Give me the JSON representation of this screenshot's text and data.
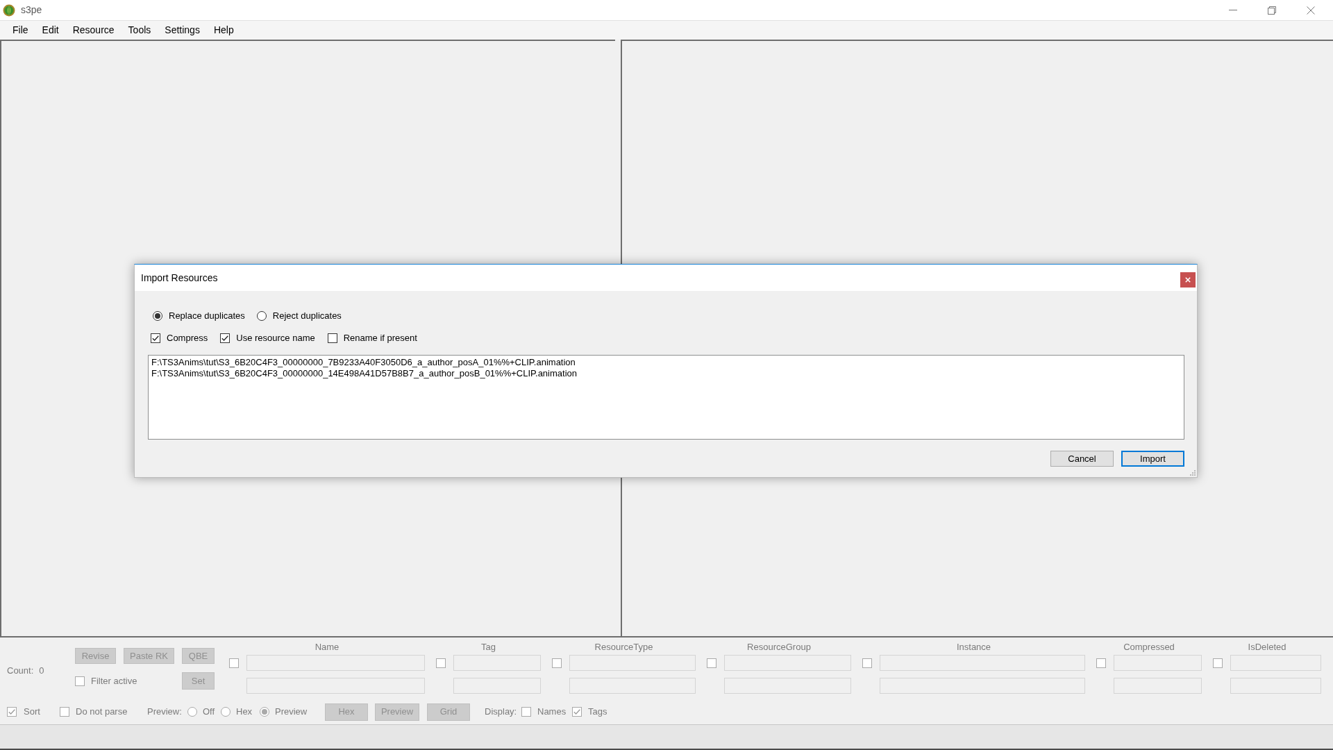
{
  "window": {
    "title": "s3pe"
  },
  "menu": [
    "File",
    "Edit",
    "Resource",
    "Tools",
    "Settings",
    "Help"
  ],
  "dialog": {
    "title": "Import Resources",
    "duplicate_options": [
      {
        "label": "Replace duplicates",
        "selected": true
      },
      {
        "label": "Reject duplicates",
        "selected": false
      }
    ],
    "options": [
      {
        "label": "Compress",
        "checked": true
      },
      {
        "label": "Use resource name",
        "checked": true
      },
      {
        "label": "Rename if present",
        "checked": false
      }
    ],
    "files": [
      "F:\\TS3Anims\\tut\\S3_6B20C4F3_00000000_7B9233A40F3050D6_a_author_posA_01%%+CLIP.animation",
      "F:\\TS3Anims\\tut\\S3_6B20C4F3_00000000_14E498A41D57B8B7_a_author_posB_01%%+CLIP.animation"
    ],
    "buttons": [
      {
        "label": "Cancel",
        "default": false
      },
      {
        "label": "Import",
        "default": true
      }
    ]
  },
  "filter_panel": {
    "count_label": "Count:",
    "count": "0",
    "buttons": [
      {
        "label": "Revise",
        "disabled": true
      },
      {
        "label": "Paste RK",
        "disabled": true
      },
      {
        "label": "QBE",
        "disabled": true
      }
    ],
    "filter_active": {
      "label": "Filter active",
      "checked": false
    },
    "set_button": {
      "label": "Set",
      "disabled": true
    },
    "columns": [
      {
        "name": "Name",
        "checked": false
      },
      {
        "name": "Tag",
        "checked": false
      },
      {
        "name": "ResourceType",
        "checked": false
      },
      {
        "name": "ResourceGroup",
        "checked": false
      },
      {
        "name": "Instance",
        "checked": false
      },
      {
        "name": "Compressed",
        "checked": false
      },
      {
        "name": "IsDeleted",
        "checked": false
      }
    ]
  },
  "options_bar": {
    "sort": {
      "label": "Sort",
      "checked": true
    },
    "do_not_parse": {
      "label": "Do not parse",
      "checked": false
    },
    "preview_label": "Preview:",
    "preview_modes": [
      {
        "label": "Off",
        "selected": false
      },
      {
        "label": "Hex",
        "selected": false
      },
      {
        "label": "Preview",
        "selected": true
      }
    ],
    "view_buttons": [
      {
        "label": "Hex",
        "disabled": true
      },
      {
        "label": "Preview",
        "disabled": true
      },
      {
        "label": "Grid",
        "disabled": true
      }
    ],
    "display_label": "Display:",
    "display": [
      {
        "label": "Names",
        "checked": false
      },
      {
        "label": "Tags",
        "checked": true
      }
    ]
  }
}
